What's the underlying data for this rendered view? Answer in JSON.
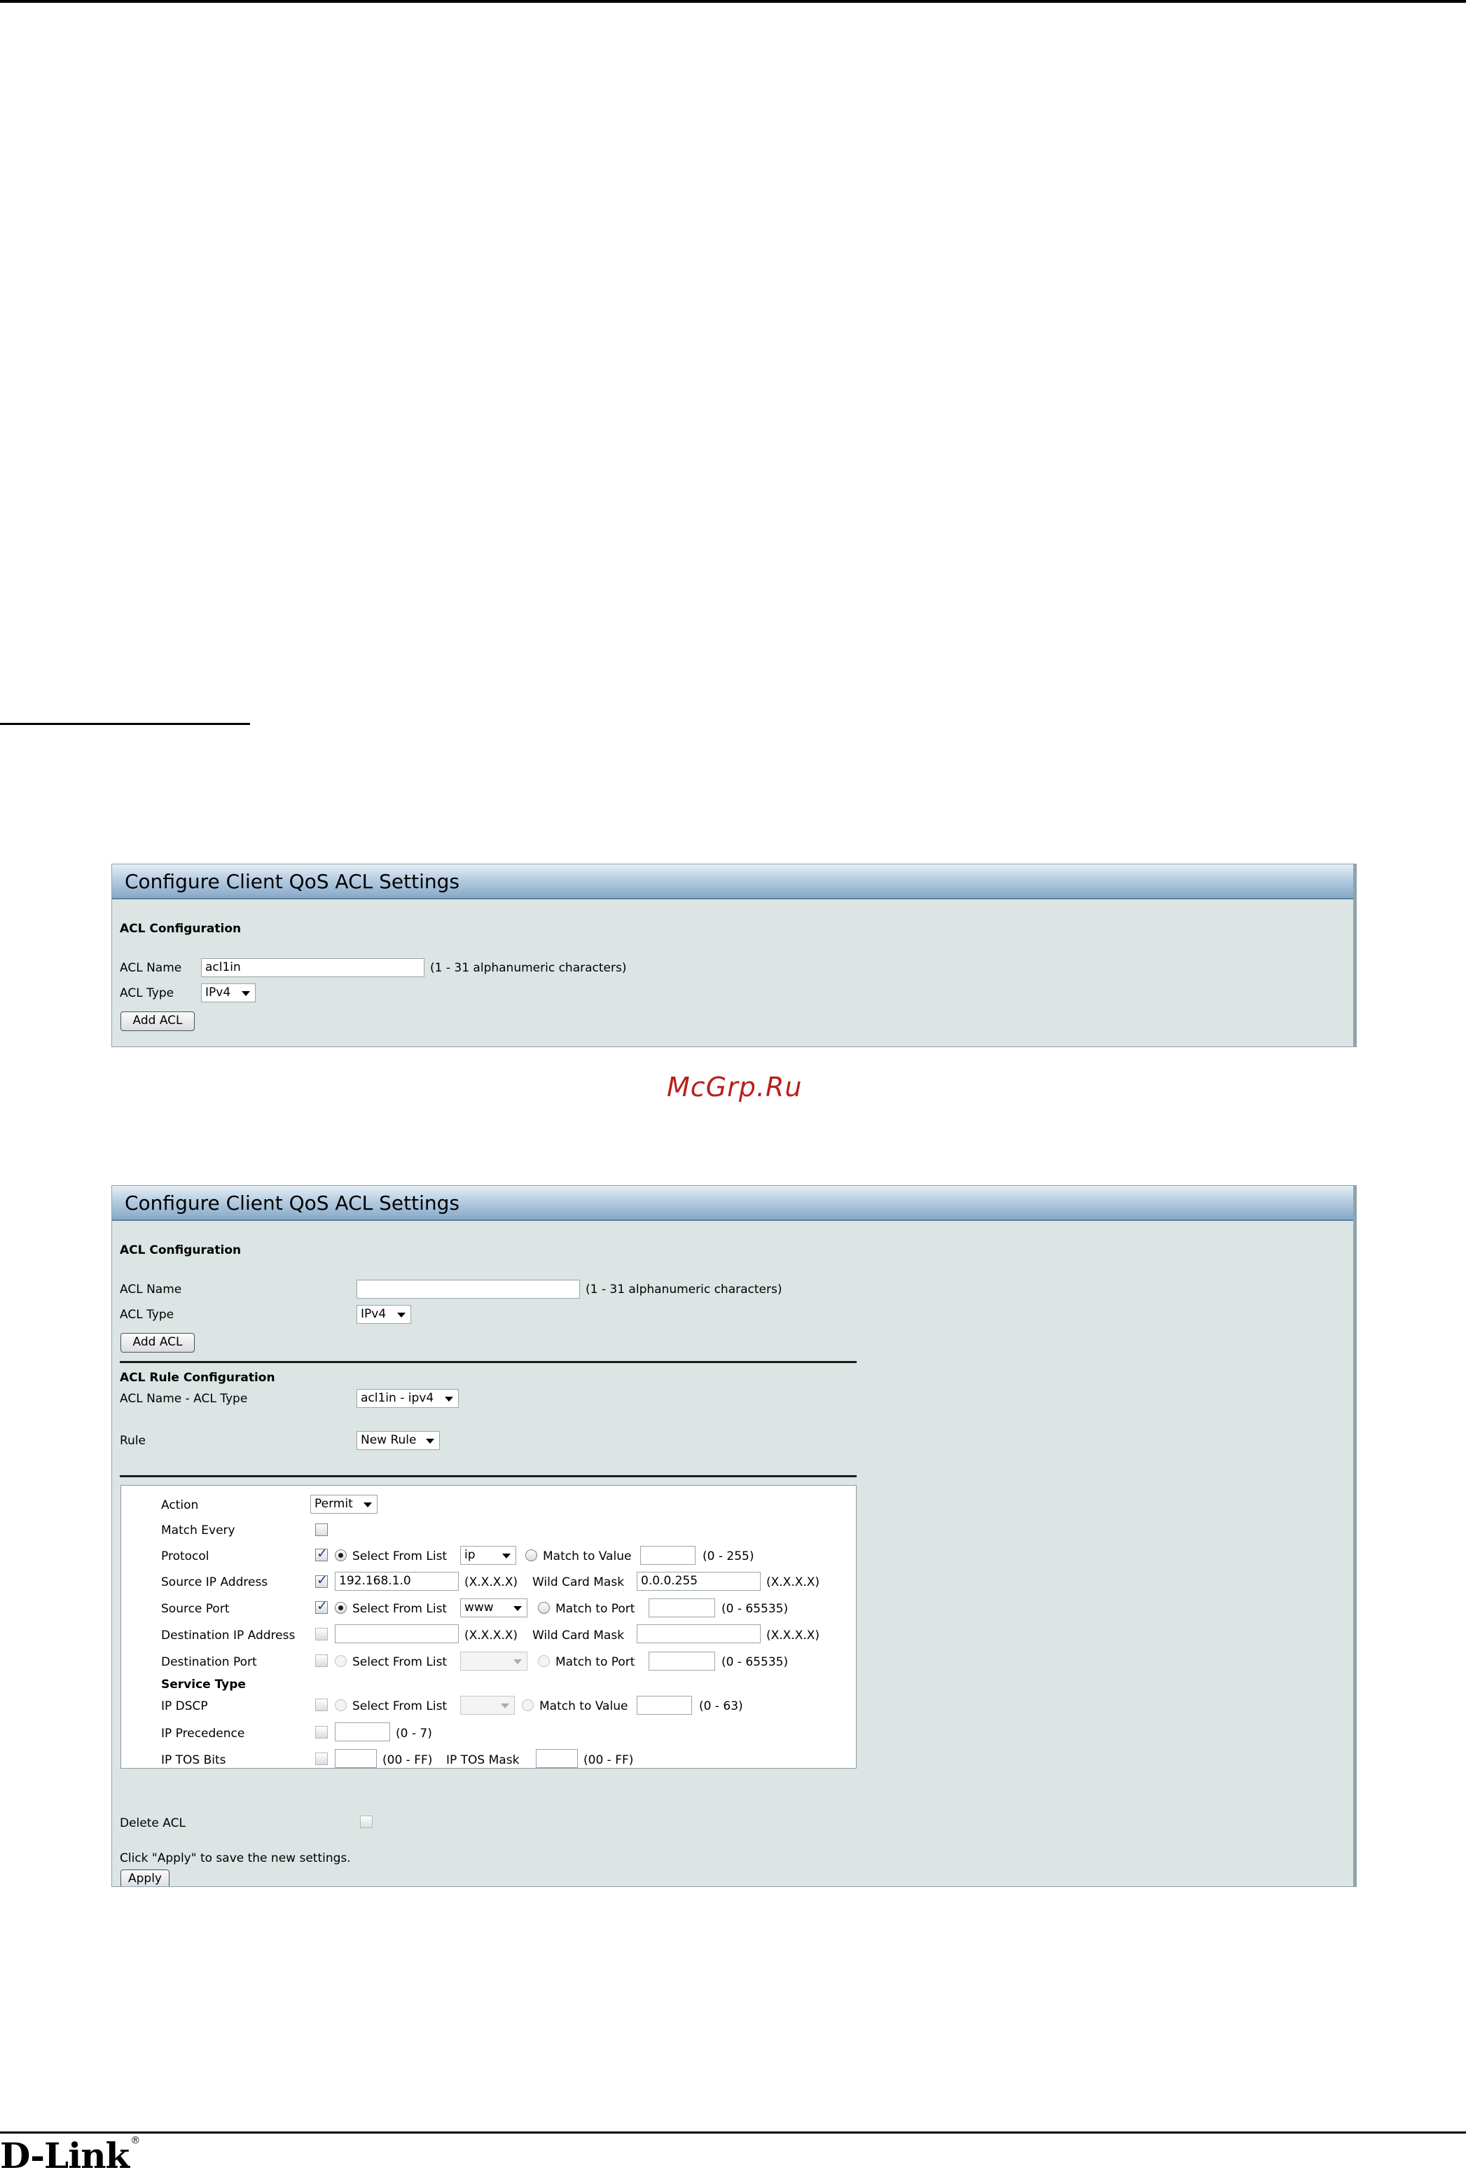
{
  "watermark": "McGrp.Ru",
  "logo": "D-Link",
  "logo_mark": "®",
  "panel1": {
    "title": "Configure Client QoS ACL Settings",
    "section": "ACL Configuration",
    "acl_name_label": "ACL Name",
    "acl_name_value": "acl1in",
    "acl_name_hint": "(1 - 31 alphanumeric characters)",
    "acl_type_label": "ACL Type",
    "acl_type_value": "IPv4",
    "add_button": "Add ACL"
  },
  "panel2": {
    "title": "Configure Client QoS ACL Settings",
    "section": "ACL Configuration",
    "acl_name_label": "ACL Name",
    "acl_name_value": "",
    "acl_name_hint": "(1 - 31 alphanumeric characters)",
    "acl_type_label": "ACL Type",
    "acl_type_value": "IPv4",
    "add_button": "Add ACL",
    "rule_section": "ACL Rule Configuration",
    "acl_name_type_label": "ACL Name - ACL Type",
    "acl_name_type_value": "acl1in - ipv4",
    "rule_label": "Rule",
    "rule_value": "New Rule",
    "rule": {
      "action_label": "Action",
      "action_value": "Permit",
      "match_every_label": "Match Every",
      "protocol_label": "Protocol",
      "select_from_list": "Select From List",
      "protocol_list_value": "ip",
      "match_to_value": "Match to Value",
      "protocol_range": "(0 - 255)",
      "source_ip_label": "Source IP Address",
      "source_ip_value": "192.168.1.0",
      "ip_format": "(X.X.X.X)",
      "wild_card_mask": "Wild Card Mask",
      "source_mask_value": "0.0.0.255",
      "source_port_label": "Source Port",
      "source_port_list_value": "www",
      "match_to_port": "Match to Port",
      "port_range": "(0 - 65535)",
      "dest_ip_label": "Destination IP Address",
      "dest_port_label": "Destination Port",
      "service_type_label": "Service Type",
      "ip_dscp_label": "IP DSCP",
      "dscp_range": "(0 - 63)",
      "ip_precedence_label": "IP Precedence",
      "precedence_range": "(0 - 7)",
      "ip_tos_bits_label": "IP TOS Bits",
      "tos_range": "(00 - FF)",
      "ip_tos_mask_label": "IP TOS Mask"
    },
    "delete_acl_label": "Delete ACL",
    "apply_note": "Click \"Apply\" to save the new settings.",
    "apply_button": "Apply"
  }
}
